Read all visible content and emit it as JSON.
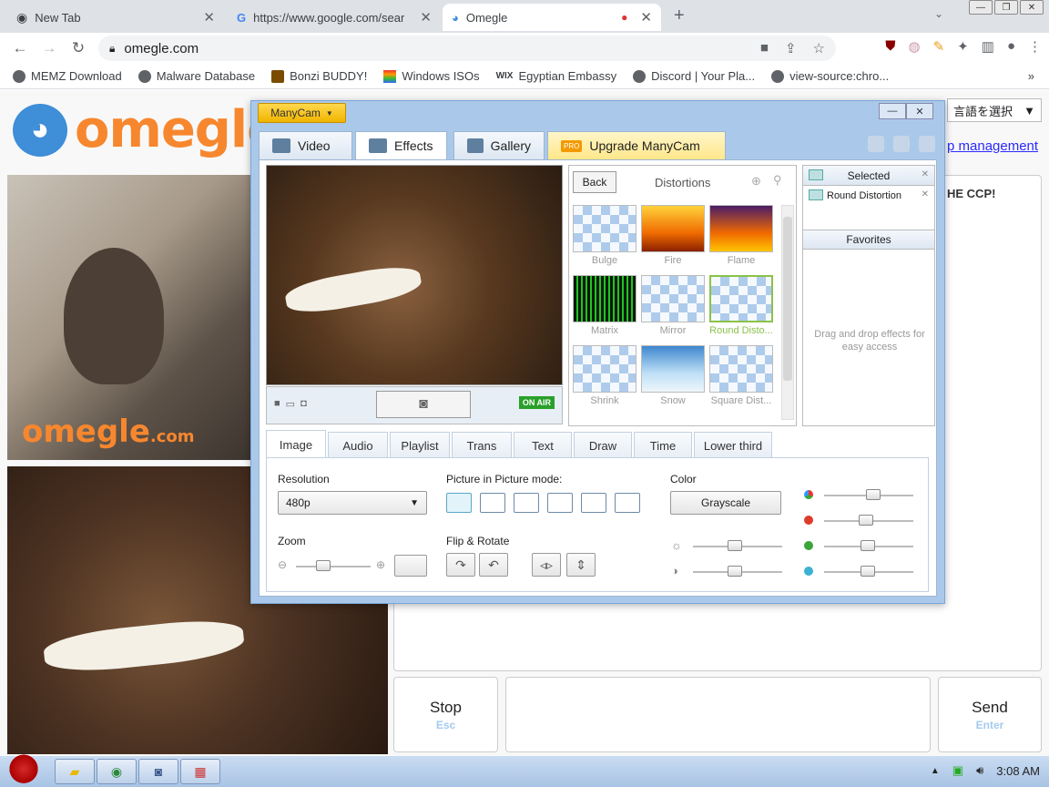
{
  "browser": {
    "tabs": [
      {
        "title": "New Tab",
        "icon": "chrome-icon"
      },
      {
        "title": "https://www.google.com/sear",
        "icon": "google-icon"
      },
      {
        "title": "Omegle",
        "icon": "omegle-icon"
      }
    ],
    "new_tab_symbol": "+",
    "address": "omegle.com",
    "bookmarks": [
      "MEMZ Download",
      "Malware Database",
      "Bonzi BUDDY!",
      "Windows ISOs",
      "Egyptian Embassy",
      "Discord | Your Pla...",
      "view-source:chro..."
    ],
    "bookmarks_more": "»"
  },
  "omegle": {
    "logo_text": "omegle",
    "video_watermark": "omegle",
    "video_watermark_suffix": ".com",
    "language_select": "言語を選択",
    "top_link": "p management",
    "chat_text": "HE CCP!",
    "stop_label": "Stop",
    "stop_sub": "Esc",
    "send_label": "Send",
    "send_sub": "Enter"
  },
  "manycam": {
    "menu_label": "ManyCam",
    "tabs": [
      "Video",
      "Effects",
      "Gallery",
      "Upgrade ManyCam"
    ],
    "pro_badge": "PRO",
    "back_label": "Back",
    "category_title": "Distortions",
    "effects": [
      "Bulge",
      "Fire",
      "Flame",
      "Matrix",
      "Mirror",
      "Round Disto...",
      "Shrink",
      "Snow",
      "Square Dist..."
    ],
    "on_air": "ON AIR",
    "selected_header": "Selected",
    "selected_items": [
      "Round Distortion"
    ],
    "favorites_header": "Favorites",
    "favorites_hint": "Drag and drop effects for easy access",
    "bottom_tabs": [
      "Image",
      "Audio",
      "Playlist",
      "Trans",
      "Text",
      "Draw",
      "Time",
      "Lower third"
    ],
    "resolution_label": "Resolution",
    "resolution_value": "480p",
    "pip_label": "Picture in Picture mode:",
    "color_label": "Color",
    "grayscale_label": "Grayscale",
    "zoom_label": "Zoom",
    "flip_label": "Flip & Rotate"
  },
  "taskbar": {
    "time": "3:08 AM"
  }
}
